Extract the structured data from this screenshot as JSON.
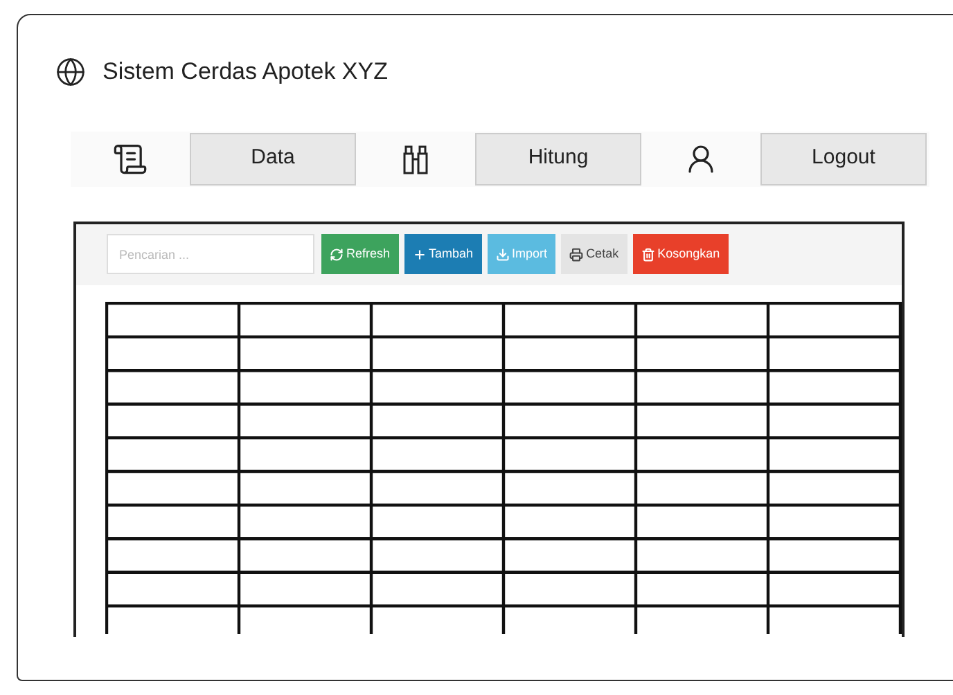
{
  "window": {
    "title": "Sistem Cerdas Apotek XYZ"
  },
  "nav": [
    {
      "label": "Data"
    },
    {
      "label": "Hitung"
    },
    {
      "label": "Logout"
    }
  ],
  "toolbar": {
    "search": {
      "placeholder": "Pencarian ..."
    },
    "buttons": [
      {
        "kind": "refresh",
        "label": "Refresh",
        "color": "#3da35d"
      },
      {
        "kind": "add",
        "label": "Tambah",
        "color": "#1c7db3"
      },
      {
        "kind": "import",
        "label": "Import",
        "color": "#5bbbe0"
      },
      {
        "kind": "print",
        "label": "Cetak",
        "color": "#e4e4e4"
      },
      {
        "kind": "delete",
        "label": "Kosongkan",
        "color": "#e8402a"
      }
    ]
  }
}
